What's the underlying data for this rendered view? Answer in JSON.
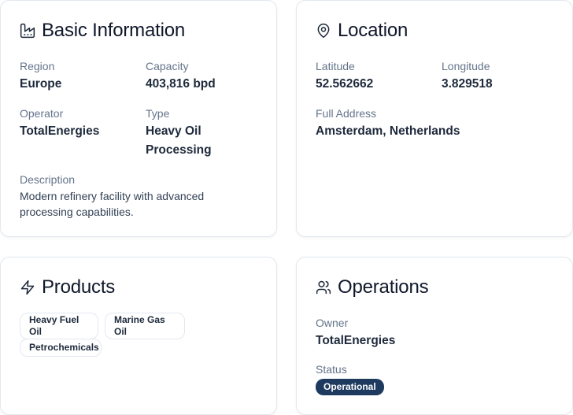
{
  "basic_info": {
    "title": "Basic Information",
    "icon": "factory-icon",
    "region_label": "Region",
    "region_value": "Europe",
    "capacity_label": "Capacity",
    "capacity_value": "403,816 bpd",
    "operator_label": "Operator",
    "operator_value": "TotalEnergies",
    "type_label": "Type",
    "type_value_line1": "Heavy Oil",
    "type_value_line2": "Processing",
    "description_label": "Description",
    "description_line1": "Modern refinery facility with advanced",
    "description_line2": "processing capabilities."
  },
  "location": {
    "title": "Location",
    "icon": "map-pin-icon",
    "latitude_label": "Latitude",
    "latitude_value": "52.562662",
    "longitude_label": "Longitude",
    "longitude_value": "3.829518",
    "address_label": "Full Address",
    "address_value": "Amsterdam, Netherlands"
  },
  "products": {
    "title": "Products",
    "icon": "zap-icon",
    "items": [
      {
        "line1": "Heavy Fuel",
        "line2": "Oil"
      },
      {
        "line1": "Marine Gas",
        "line2": "Oil"
      },
      {
        "line1": "Petrochemicals",
        "line2": ""
      }
    ]
  },
  "operations": {
    "title": "Operations",
    "icon": "users-icon",
    "owner_label": "Owner",
    "owner_value": "TotalEnergies",
    "status_label": "Status",
    "status_value": "Operational"
  },
  "colors": {
    "border": "#e2e8f0",
    "label": "#64748b",
    "value": "#1e293b",
    "badge_bg": "#1e3a5f",
    "badge_text": "#ffffff"
  }
}
